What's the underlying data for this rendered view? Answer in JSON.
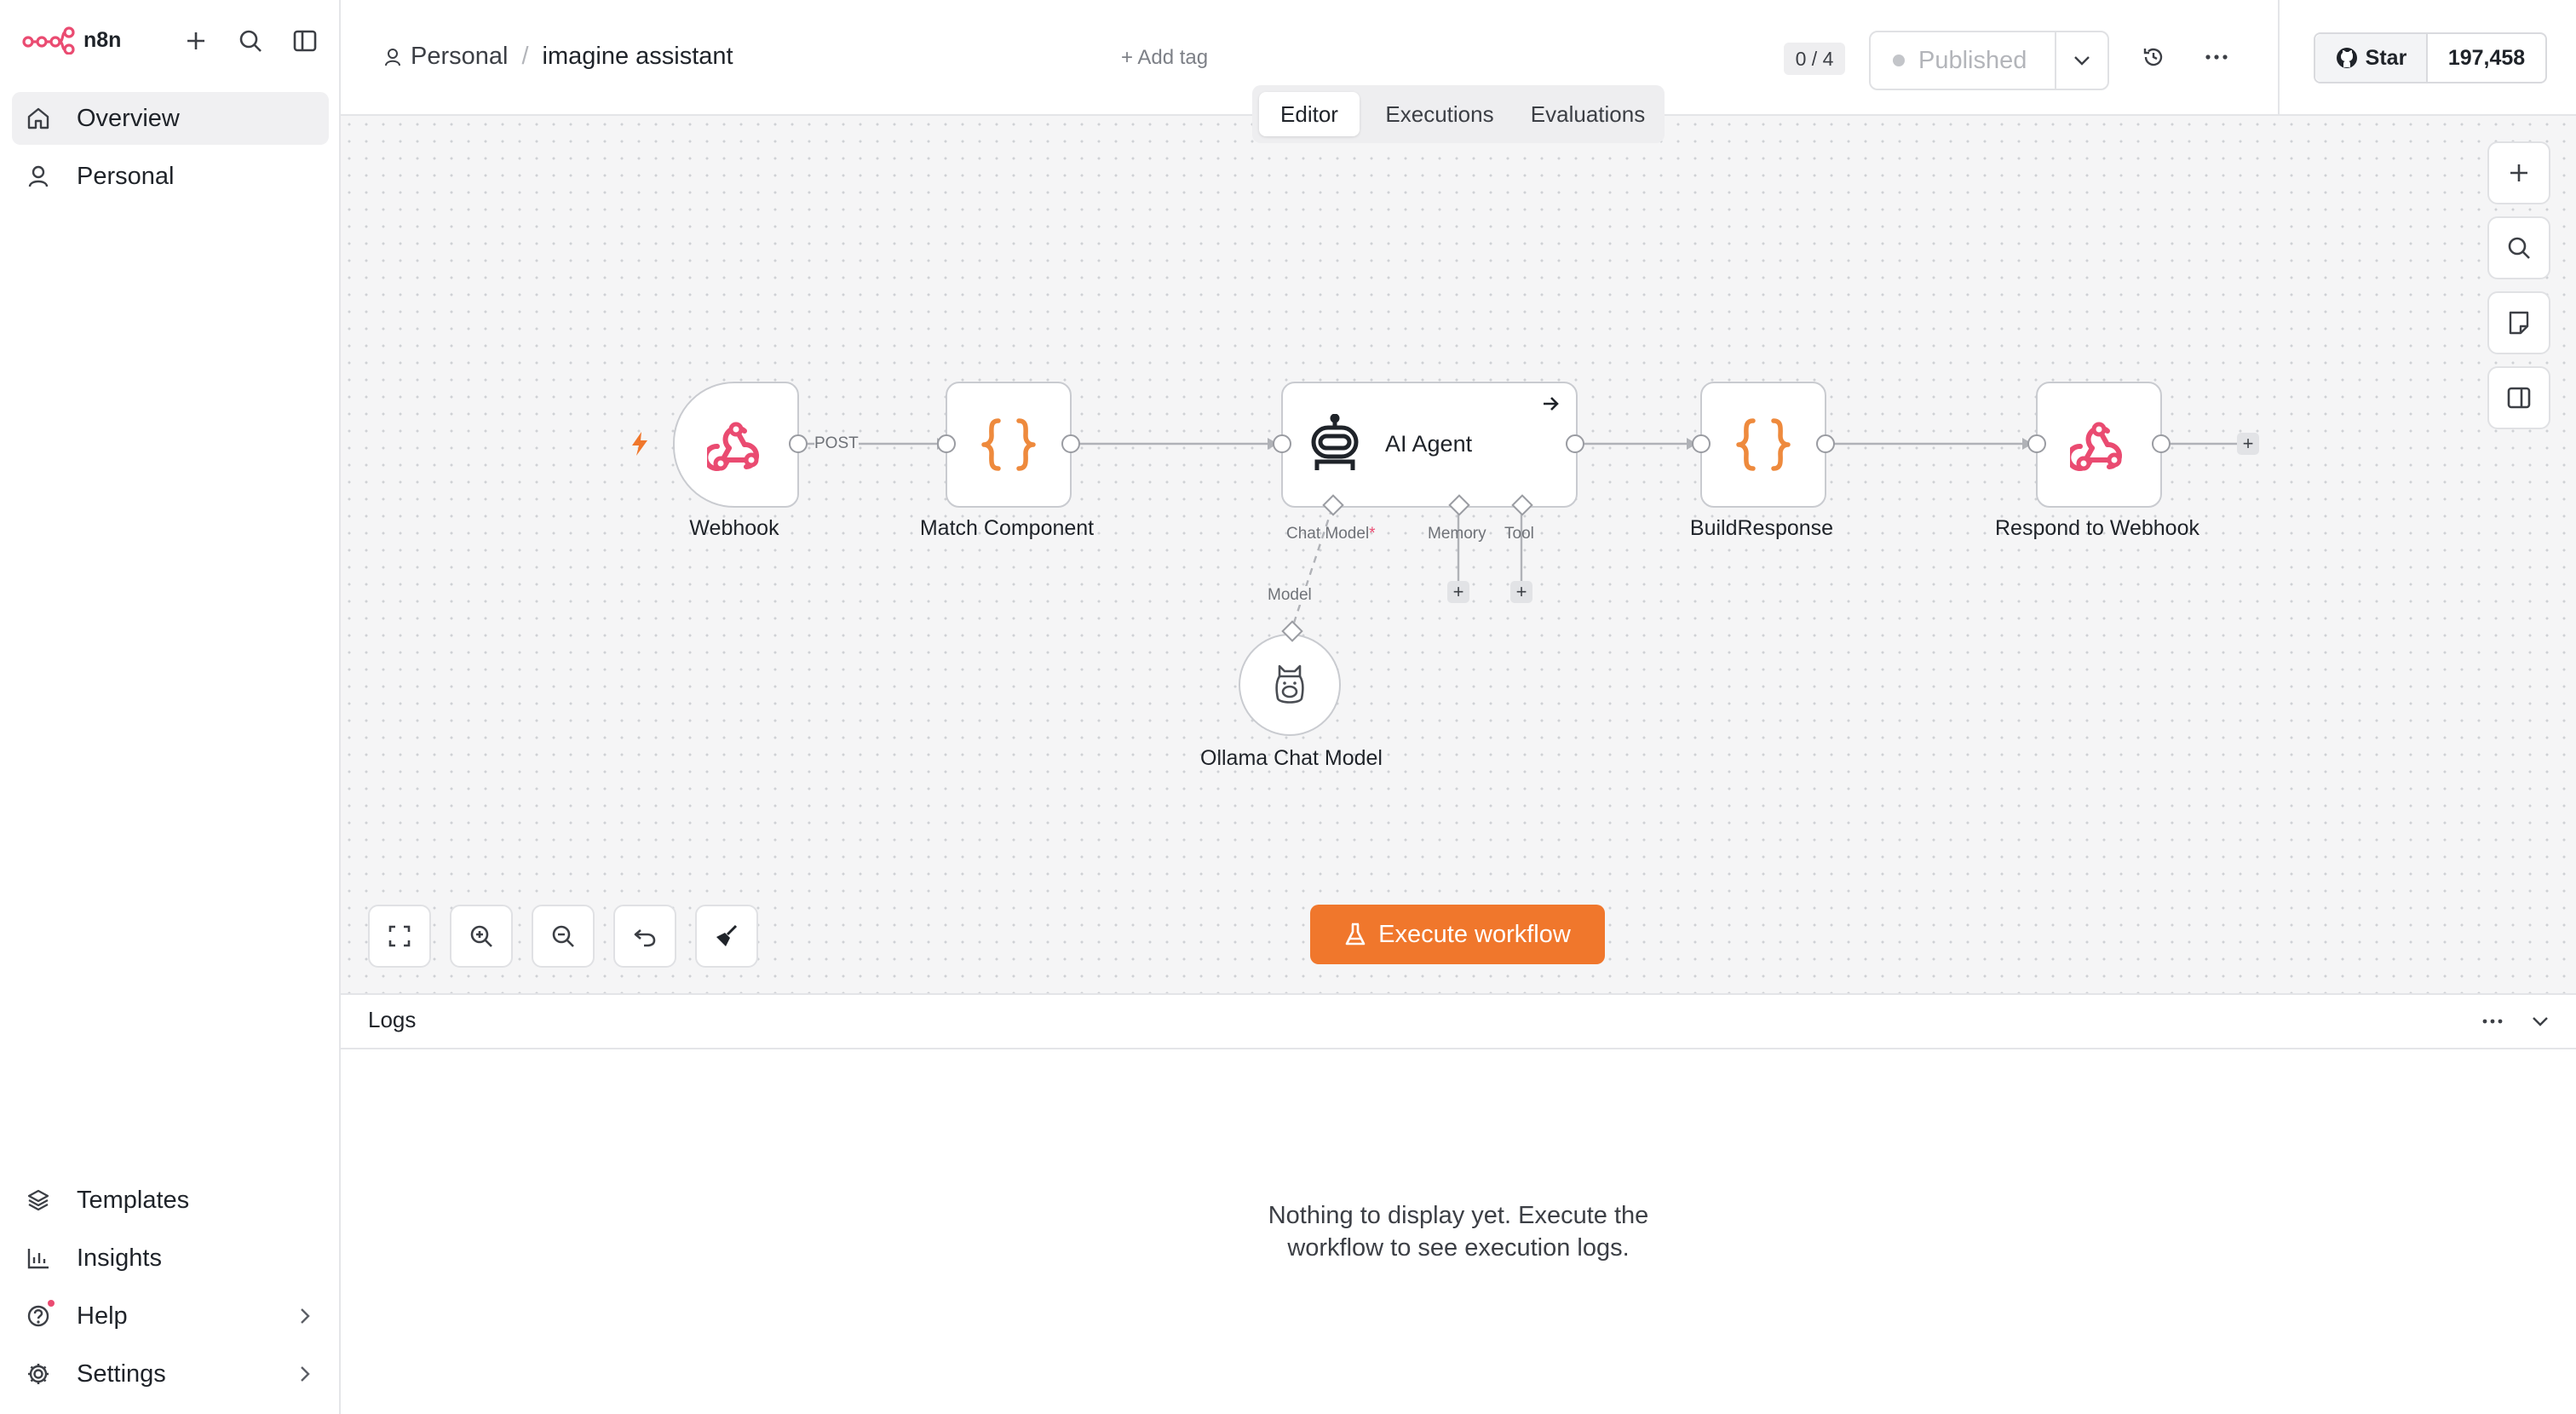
{
  "app": {
    "name": "n8n",
    "accent": "#ea4b71",
    "primary": "#f0772c"
  },
  "sidebar": {
    "top_items": [
      {
        "label": "Overview",
        "icon": "home-icon",
        "active": true
      },
      {
        "label": "Personal",
        "icon": "user-icon",
        "active": false
      }
    ],
    "bottom_items": [
      {
        "label": "Templates",
        "icon": "templates-icon"
      },
      {
        "label": "Insights",
        "icon": "chart-icon"
      },
      {
        "label": "Help",
        "icon": "help-icon"
      },
      {
        "label": "Settings",
        "icon": "gear-icon"
      }
    ]
  },
  "header": {
    "breadcrumb_project": "Personal",
    "separator": "/",
    "workflow_name": "imagine assistant",
    "add_tag": "+ Add tag",
    "counter": "0 / 4",
    "publish_label": "Published",
    "github_star": "Star",
    "github_count": "197,458",
    "tabs": [
      "Editor",
      "Executions",
      "Evaluations"
    ],
    "active_tab": "Editor"
  },
  "canvas": {
    "nodes": [
      {
        "name": "Webhook",
        "icon": "webhook-icon"
      },
      {
        "name": "Match Component",
        "icon": "code-braces-icon"
      },
      {
        "name": "AI Agent",
        "icon": "robot-icon"
      },
      {
        "name": "BuildResponse",
        "icon": "code-braces-icon"
      },
      {
        "name": "Respond to Webhook",
        "icon": "webhook-icon"
      },
      {
        "name": "Ollama Chat Model",
        "icon": "llama-icon"
      }
    ],
    "edge_label_post": "POST",
    "agent_inputs": {
      "chat_model": "Chat Model",
      "required_mark": "*",
      "memory": "Memory",
      "tool": "Tool"
    },
    "model_label": "Model",
    "execute_label": "Execute workflow"
  },
  "logs": {
    "title": "Logs",
    "empty_line1": "Nothing to display yet. Execute the",
    "empty_line2": "workflow to see execution logs."
  }
}
